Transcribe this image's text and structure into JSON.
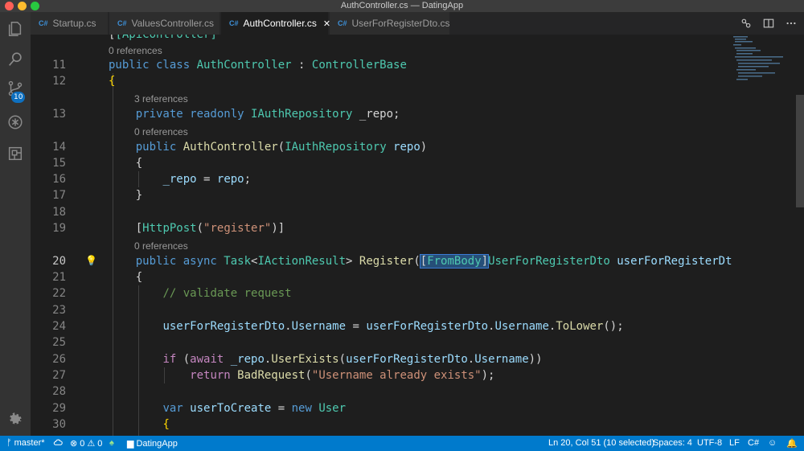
{
  "window": {
    "title": "AuthController.cs — DatingApp"
  },
  "activity_bar": {
    "items": [
      "explorer-icon",
      "search-icon",
      "source-control-icon",
      "debug-icon",
      "extensions-icon"
    ],
    "source_control_badge": "10",
    "settings": "gear-icon"
  },
  "tabs": [
    {
      "label": "Startup.cs",
      "active": false
    },
    {
      "label": "ValuesController.cs",
      "active": false
    },
    {
      "label": "AuthController.cs",
      "active": true
    },
    {
      "label": "UserForRegisterDto.cs",
      "active": false
    }
  ],
  "tab_lang_label": "C#",
  "tab_close": "✕",
  "editor": {
    "top_partial": "[ApiController]",
    "lenses": {
      "l10": "0 references",
      "l12": "3 references",
      "l13": "0 references",
      "l18": "0 references"
    },
    "line_numbers": [
      "11",
      "12",
      "13",
      "14",
      "15",
      "16",
      "17",
      "18",
      "19",
      "20",
      "21",
      "22",
      "23",
      "24",
      "25",
      "26",
      "27",
      "28",
      "29",
      "30"
    ],
    "current_line": "20"
  },
  "status": {
    "branch": "master*",
    "errors": "0",
    "warnings": "0",
    "project": "DatingApp",
    "cursor": "Ln 20, Col 51 (10 selected)",
    "spaces": "Spaces: 4",
    "encoding": "UTF-8",
    "eol": "LF",
    "language": "C#"
  },
  "colors": {
    "statusbar": "#007acc",
    "keyword": "#569cd6",
    "type": "#4ec9b0",
    "function": "#dcdcaa",
    "string": "#ce9178",
    "comment": "#6a9955"
  }
}
